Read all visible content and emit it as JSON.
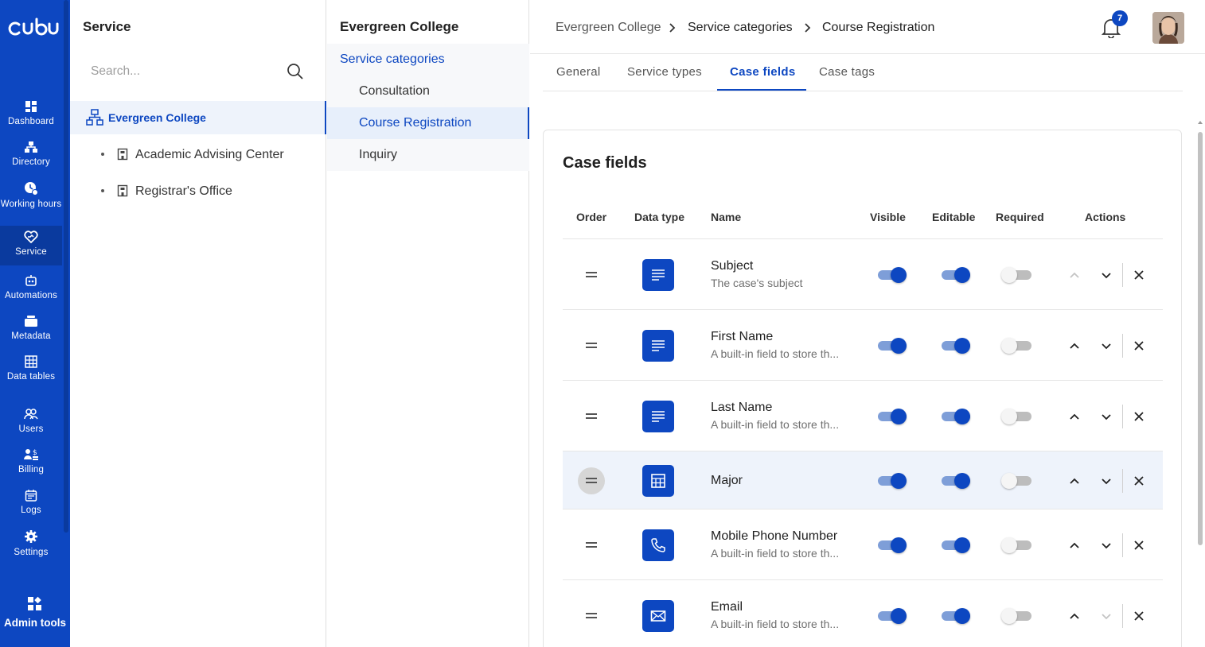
{
  "brand": {
    "logo_text": "cubu",
    "accent": "#0d47c1"
  },
  "nav": {
    "items": [
      {
        "label": "Dashboard",
        "icon": "dashboard-icon"
      },
      {
        "label": "Directory",
        "icon": "directory-icon"
      },
      {
        "label": "Working hours",
        "icon": "working-hours-icon"
      },
      {
        "label": "Service",
        "icon": "service-icon",
        "active": true
      },
      {
        "label": "Automations",
        "icon": "robot-icon"
      },
      {
        "label": "Metadata",
        "icon": "metadata-icon"
      },
      {
        "label": "Data tables",
        "icon": "table-icon"
      },
      {
        "label": "Users",
        "icon": "users-icon"
      },
      {
        "label": "Billing",
        "icon": "billing-icon"
      },
      {
        "label": "Logs",
        "icon": "calendar-icon"
      },
      {
        "label": "Settings",
        "icon": "gear-icon"
      }
    ],
    "admin_tools": "Admin tools"
  },
  "tree_panel": {
    "title": "Service",
    "search_placeholder": "Search...",
    "root": "Evergreen College",
    "children": [
      "Academic Advising Center",
      "Registrar's Office"
    ]
  },
  "category_panel": {
    "title": "Evergreen College",
    "heading": "Service categories",
    "items": [
      "Consultation",
      "Course Registration",
      "Inquiry"
    ],
    "selected": "Course Registration"
  },
  "header": {
    "breadcrumb": [
      "Evergreen College",
      "Service categories",
      "Course Registration"
    ],
    "notification_count": "7"
  },
  "tabs": [
    "General",
    "Service types",
    "Case fields",
    "Case tags"
  ],
  "active_tab": "Case fields",
  "case_fields": {
    "title": "Case fields",
    "columns": [
      "Order",
      "Data type",
      "Name",
      "Visible",
      "Editable",
      "Required",
      "Actions"
    ],
    "rows": [
      {
        "name": "Subject",
        "description": "The case's subject",
        "type_icon": "text-icon",
        "visible": true,
        "editable": true,
        "required": false,
        "up_enabled": false,
        "down_enabled": true
      },
      {
        "name": "First Name",
        "description": "A built-in field to store th...",
        "type_icon": "text-icon",
        "visible": true,
        "editable": true,
        "required": false,
        "up_enabled": true,
        "down_enabled": true
      },
      {
        "name": "Last Name",
        "description": "A built-in field to store th...",
        "type_icon": "text-icon",
        "visible": true,
        "editable": true,
        "required": false,
        "up_enabled": true,
        "down_enabled": true
      },
      {
        "name": "Major",
        "description": "",
        "type_icon": "table-icon",
        "visible": true,
        "editable": true,
        "required": false,
        "up_enabled": true,
        "down_enabled": true,
        "highlighted": true
      },
      {
        "name": "Mobile Phone Number",
        "description": "A built-in field to store th...",
        "type_icon": "phone-icon",
        "visible": true,
        "editable": true,
        "required": false,
        "up_enabled": true,
        "down_enabled": true
      },
      {
        "name": "Email",
        "description": "A built-in field to store th...",
        "type_icon": "envelope-icon",
        "visible": true,
        "editable": true,
        "required": false,
        "up_enabled": true,
        "down_enabled": false
      }
    ]
  }
}
